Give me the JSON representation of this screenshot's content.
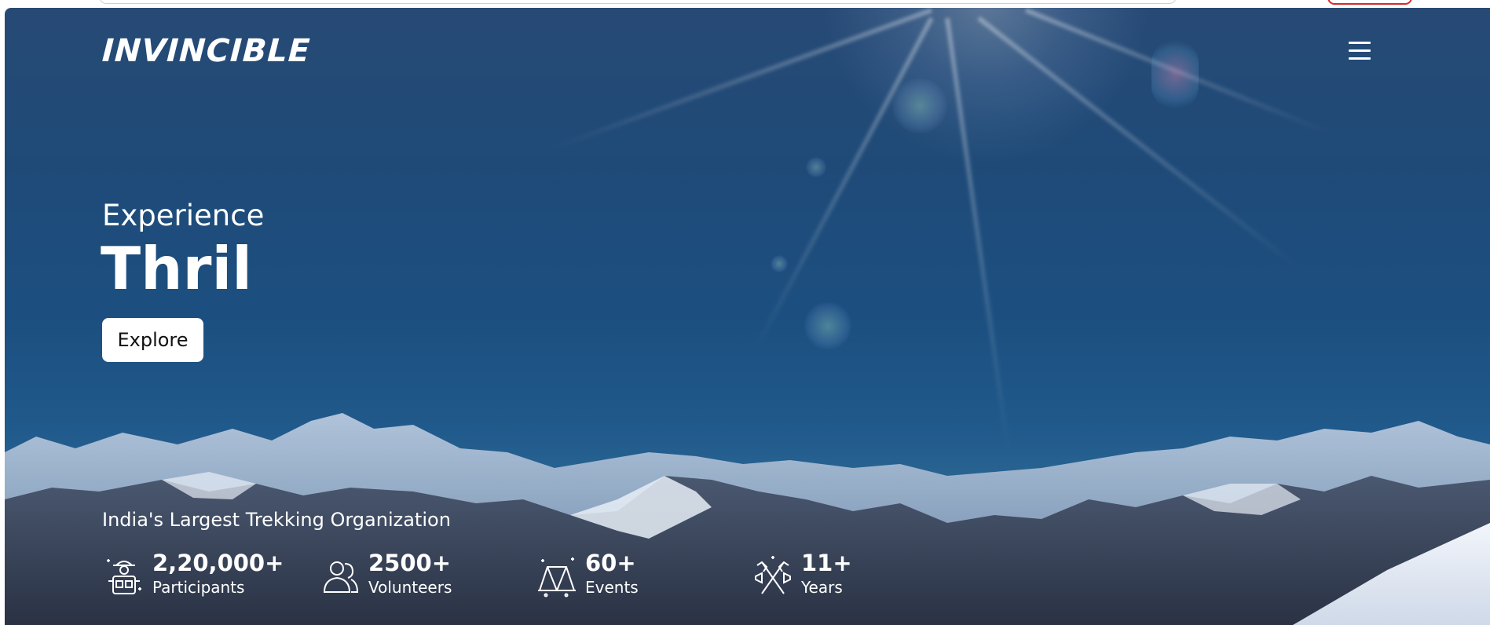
{
  "header": {
    "logo_text": "INVINCIBLE",
    "menu_icon": "hamburger-menu-icon"
  },
  "hero": {
    "eyebrow": "Experience",
    "headline": "Thril",
    "cta_label": "Explore",
    "tagline": "India's Largest Trekking Organization"
  },
  "stats": [
    {
      "value": "2,20,000+",
      "label": "Participants",
      "icon": "hiker-backpack-icon"
    },
    {
      "value": "2500+",
      "label": "Volunteers",
      "icon": "people-icon"
    },
    {
      "value": "60+",
      "label": "Events",
      "icon": "tent-icon"
    },
    {
      "value": "11+",
      "label": "Years",
      "icon": "crossed-ice-axes-icon"
    }
  ],
  "colors": {
    "hero_sky_top": "#274a75",
    "hero_sky_bottom": "#2b5c83",
    "text": "#ffffff",
    "button_bg": "#ffffff",
    "button_text": "#111111",
    "accent_red": "#d62a2a"
  }
}
